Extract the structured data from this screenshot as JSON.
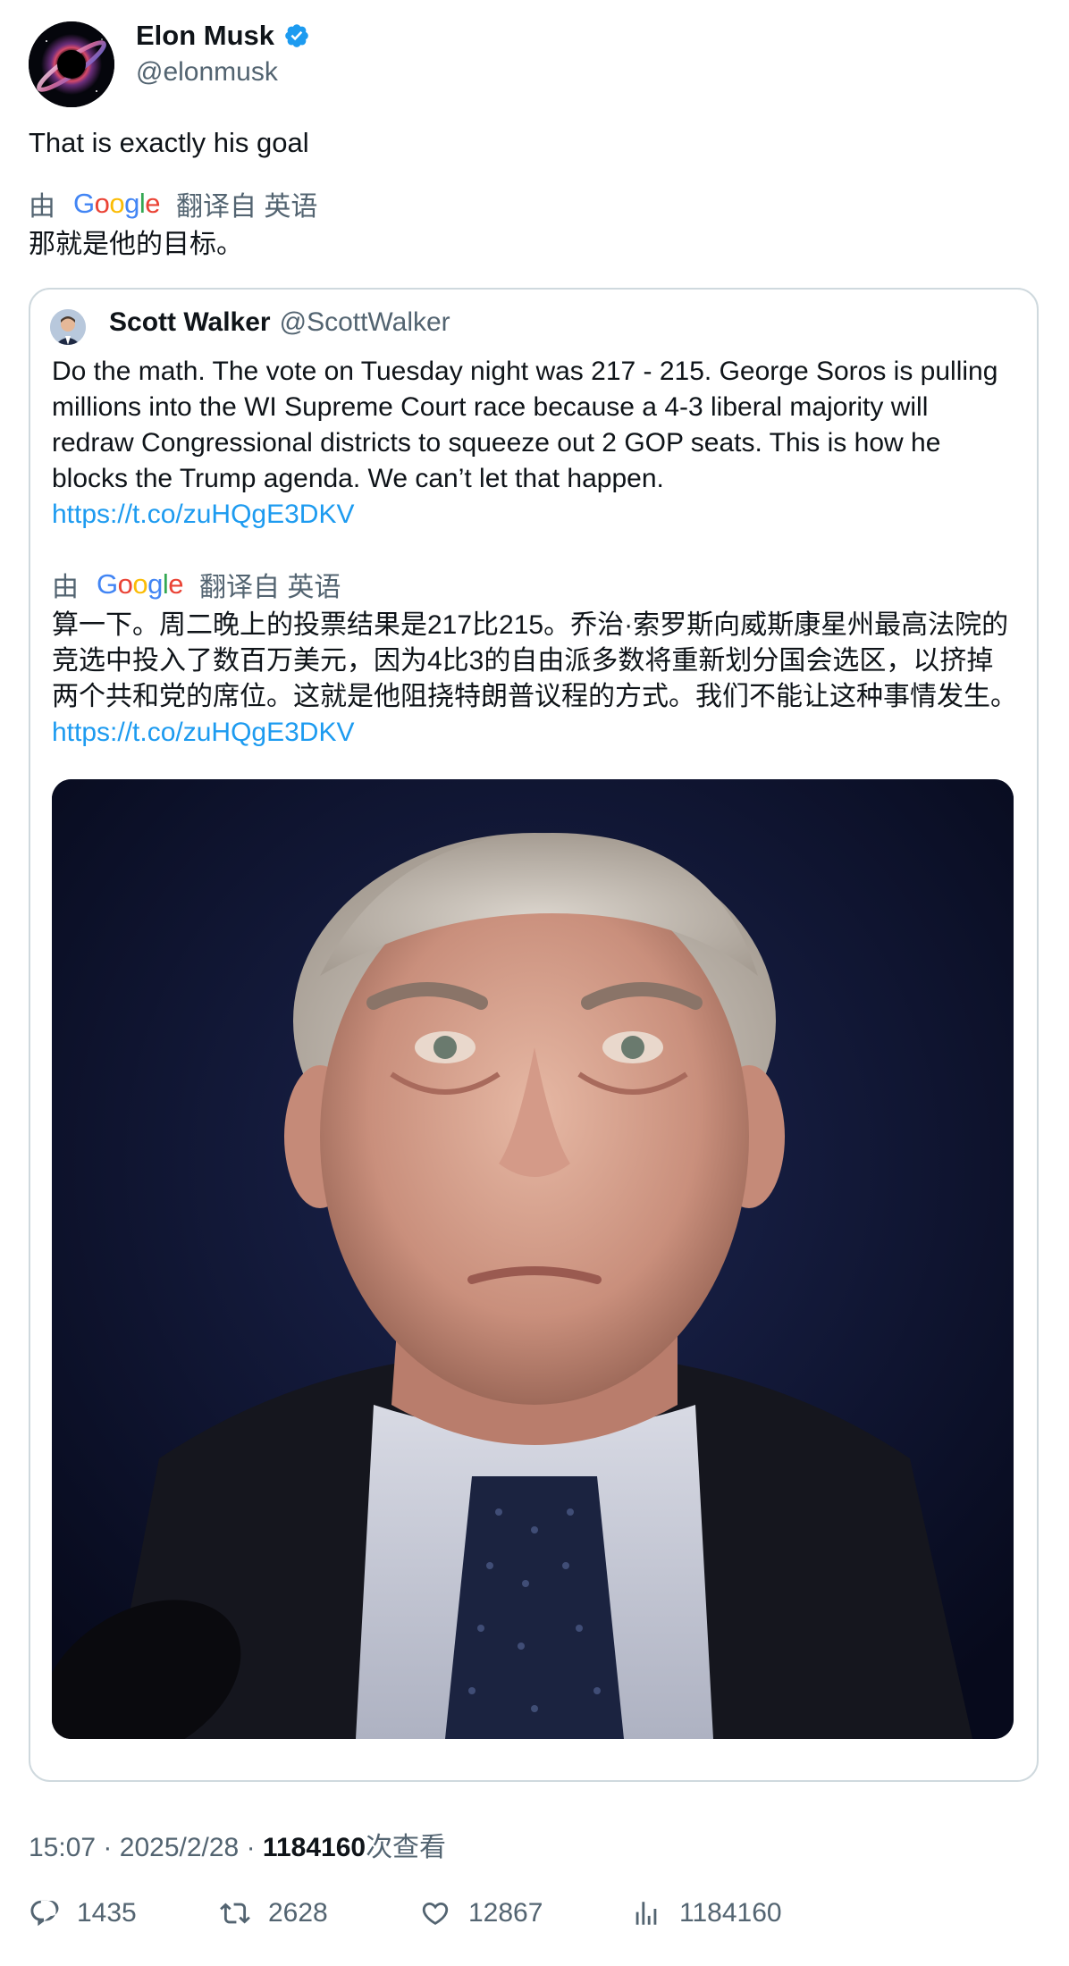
{
  "author": {
    "name": "Elon Musk",
    "handle": "@elonmusk",
    "verified": true
  },
  "tweet": {
    "text": "That is exactly his goal",
    "translation": {
      "prefix": "由",
      "provider": "Google",
      "suffix": "翻译自 英语",
      "text": "那就是他的目标。"
    }
  },
  "quote": {
    "name": "Scott Walker",
    "handle": "@ScottWalker",
    "text": "Do the math. The vote on Tuesday night was 217 - 215. George Soros is pulling millions into the WI Supreme Court race because a 4-3 liberal majority will redraw Congressional districts to squeeze out 2 GOP seats. This is how he blocks the Trump agenda. We can’t let that happen.",
    "link": "https://t.co/zuHQgE3DKV",
    "translation": {
      "prefix": "由",
      "provider": "Google",
      "suffix": "翻译自 英语",
      "text": "算一下。周二晚上的投票结果是217比215。乔治·索罗斯向威斯康星州最高法院的竞选中投入了数百万美元，因为4比3的自由派多数将重新划分国会选区，以挤掉两个共和党的席位。这就是他阻挠特朗普议程的方式。我们不能让这种事情发生。",
      "link": "https://t.co/zuHQgE3DKV"
    }
  },
  "meta": {
    "time": "15:07",
    "separator": "·",
    "date": "2025/2/28",
    "views_count": "1184160",
    "views_label": "次查看"
  },
  "actions": {
    "replies": "1435",
    "retweets": "2628",
    "likes": "12867",
    "views": "1184160"
  },
  "colors": {
    "link": "#1d9bf0",
    "secondary_text": "#536471",
    "verified_badge": "#1d9bf0"
  }
}
